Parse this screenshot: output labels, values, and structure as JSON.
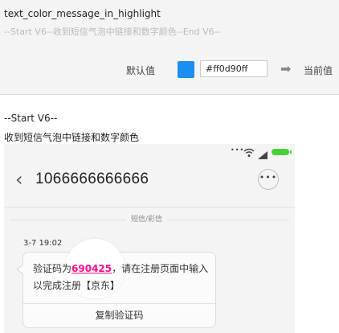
{
  "setting": {
    "key": "text_color_message_in_highlight",
    "description": "--Start V6--收到短信气泡中链接和数字颜色--End V6--",
    "default_label": "默认值",
    "color_value": "#ff0d90ff",
    "swatch_color": "#1a8ff0",
    "arrow_icon": "arrow-right-icon",
    "current_label": "当前值"
  },
  "preview": {
    "section_tag": "--Start V6--",
    "section_desc": "收到短信气泡中链接和数字颜色",
    "status_dots": "•••",
    "contact": "1066666666666",
    "sms_type": "短信/彩信",
    "time": "3-7 19:02",
    "msg_prefix": "验证码为",
    "msg_code": "690425",
    "msg_suffix": "，请在注册页面中输入以完成注册【京东】",
    "copy_button": "复制验证码",
    "highlight_color": "#ff0d90",
    "battery_color": "#4ccd3b"
  }
}
